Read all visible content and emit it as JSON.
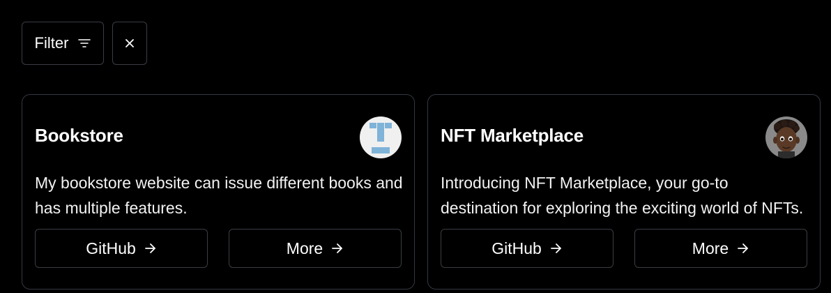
{
  "toolbar": {
    "filter_label": "Filter",
    "filter_icon": "filter-lines-icon",
    "clear_icon": "close-icon"
  },
  "cards": [
    {
      "title": "Bookstore",
      "description": "My bookstore website can issue different books and has multiple features.",
      "github_label": "GitHub",
      "more_label": "More",
      "avatar_icon": "identicon-avatar"
    },
    {
      "title": "NFT Marketplace",
      "description": "Introducing NFT Marketplace, your go-to destination for exploring the exciting world of NFTs.",
      "github_label": "GitHub",
      "more_label": "More",
      "avatar_icon": "memoji-avatar"
    }
  ],
  "colors": {
    "background": "#000000",
    "border": "#3a3d44",
    "text": "#ffffff",
    "identicon_blue": "#7fb3d8",
    "identicon_bg": "#f0f0f0"
  }
}
